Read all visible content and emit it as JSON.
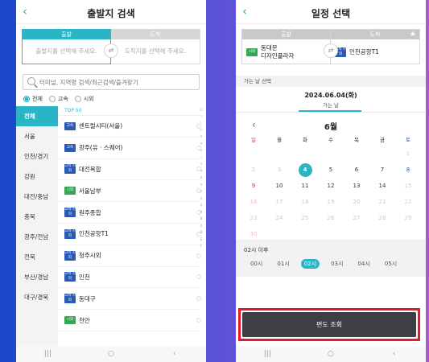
{
  "left": {
    "title": "출발지 검색",
    "departure_tab": "출발",
    "arrival_tab": "도착",
    "departure_placeholder": "출발지를 선택해 주세요.",
    "arrival_placeholder": "도착지를 선택해 주세요.",
    "search_placeholder": "터미널, 지역명 검색/최근검색/즐겨찾기",
    "filters": [
      "전체",
      "고속",
      "시외"
    ],
    "regions": [
      "전체",
      "서울",
      "인천/경기",
      "강원",
      "대전/충남",
      "충북",
      "광주/전남",
      "전북",
      "부산/경남",
      "대구/경북"
    ],
    "top_label": "TOP 50",
    "terminals": [
      {
        "type": "express",
        "badge": "고속",
        "name": "센트럴시티(서울)"
      },
      {
        "type": "express",
        "badge": "고속",
        "name": "광주(유 · 스퀘어)"
      },
      {
        "type": "both",
        "badge": "고속 시외",
        "name": "대전복합"
      },
      {
        "type": "intercity",
        "badge": "시외",
        "name": "서울남부"
      },
      {
        "type": "both",
        "badge": "고속 시외",
        "name": "원주종합"
      },
      {
        "type": "both",
        "badge": "고속 시외",
        "name": "인천공항T1"
      },
      {
        "type": "both",
        "badge": "고속 시외",
        "name": "청주시외"
      },
      {
        "type": "both",
        "badge": "고속 시외",
        "name": "인천"
      },
      {
        "type": "both",
        "badge": "고속 시외",
        "name": "동대구"
      },
      {
        "type": "intercity",
        "badge": "시외",
        "name": "천안"
      }
    ],
    "index_chars": [
      "□",
      "ㄱ",
      "ㄴ",
      "ㄷ",
      "ㄹ",
      "ㅁ",
      "ㅂ",
      "ㅅ",
      "ㅇ",
      "ㅈ",
      "ㅊ",
      "ㅋ",
      "ㅌ",
      "ㅍ",
      "ㅎ",
      "A",
      "B",
      "C",
      "D",
      "E",
      "F"
    ]
  },
  "right": {
    "title": "일정 선택",
    "departure_tab": "출발",
    "arrival_tab": "도착",
    "departure_badge": "시외",
    "departure_name_1": "동대문",
    "departure_name_2": "디자인플라자",
    "arrival_badge": "고속 시외",
    "arrival_name": "인천공항T1",
    "section_label": "가는 날 선택",
    "selected_date": "2024.06.04(화)",
    "selected_sub": "가는 날",
    "month": "6월",
    "weekdays": [
      "일",
      "월",
      "화",
      "수",
      "목",
      "금",
      "토"
    ],
    "weeks": [
      [
        "",
        "",
        "",
        "",
        "",
        "",
        "1"
      ],
      [
        "2",
        "3",
        "4",
        "5",
        "6",
        "7",
        "8"
      ],
      [
        "9",
        "10",
        "11",
        "12",
        "13",
        "14",
        "15"
      ],
      [
        "16",
        "17",
        "18",
        "19",
        "20",
        "21",
        "22"
      ],
      [
        "23",
        "24",
        "25",
        "26",
        "27",
        "28",
        "29"
      ],
      [
        "30",
        "",
        "",
        "",
        "",
        "",
        ""
      ]
    ],
    "selected_day": "4",
    "time_label": "02시 이후",
    "times": [
      "00시",
      "01시",
      "02시",
      "03시",
      "04시",
      "05시"
    ],
    "selected_time": "02시",
    "confirm_button": "편도 조회"
  },
  "colors": {
    "accent": "#2ab5c7",
    "express_badge": "#2a5ab7",
    "intercity_badge": "#34a853",
    "highlight_box": "#e9172b",
    "button_bg": "#3d3f44"
  },
  "icons": {
    "back": "chevron-left-icon",
    "swap": "swap-icon",
    "search": "search-icon",
    "favorite": "star-icon",
    "prev_month": "chevron-left-icon"
  }
}
